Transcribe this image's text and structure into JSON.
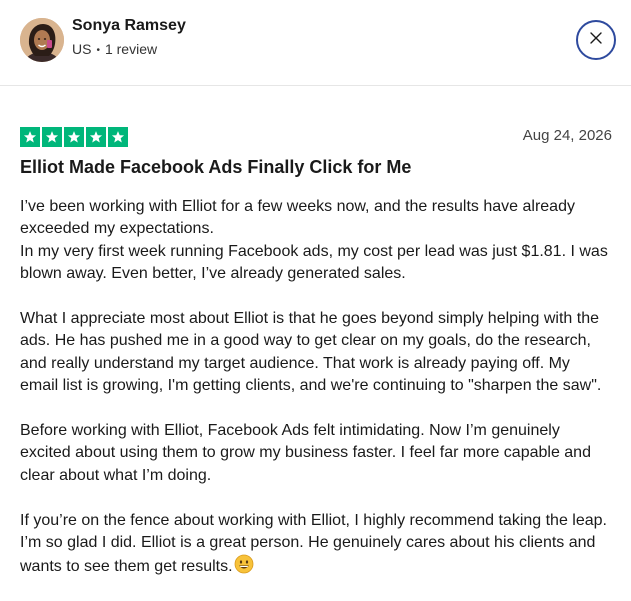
{
  "reviewer": {
    "name": "Sonya Ramsey",
    "country": "US",
    "separator": "•",
    "reviews_count": "1 review"
  },
  "review": {
    "rating": 5,
    "date": "Aug 24, 2026",
    "title": "Elliot Made Facebook Ads Finally Click for Me",
    "paragraphs": [
      "I’ve been working with Elliot for a few weeks now, and the results have already exceeded my expectations.",
      "In my very first week running Facebook ads, my cost per lead was just $1.81. I was blown away. Even better, I’ve already generated sales.",
      "What I appreciate most about Elliot is that he goes beyond simply helping with the ads. He has pushed me in a good way to get clear on my goals, do the research, and really understand my target audience. That work is already paying off. My email list is growing, I'm getting clients, and we're continuing to \"sharpen the saw\".",
      "Before working with Elliot, Facebook Ads felt intimidating. Now I’m genuinely excited about using them to grow my business faster. I feel far more capable and clear about what I’m doing.",
      "If you’re on the fence about working with Elliot, I highly recommend taking the leap. I’m so glad I did. Elliot is a great person. He genuinely cares about his clients and wants to see them get results."
    ],
    "trailing_emoji": "grinning-face-emoji"
  },
  "icons": {
    "close": "close-icon",
    "star": "star-icon"
  },
  "colors": {
    "star_green": "#00b67a",
    "close_border": "#2e4a9e"
  }
}
